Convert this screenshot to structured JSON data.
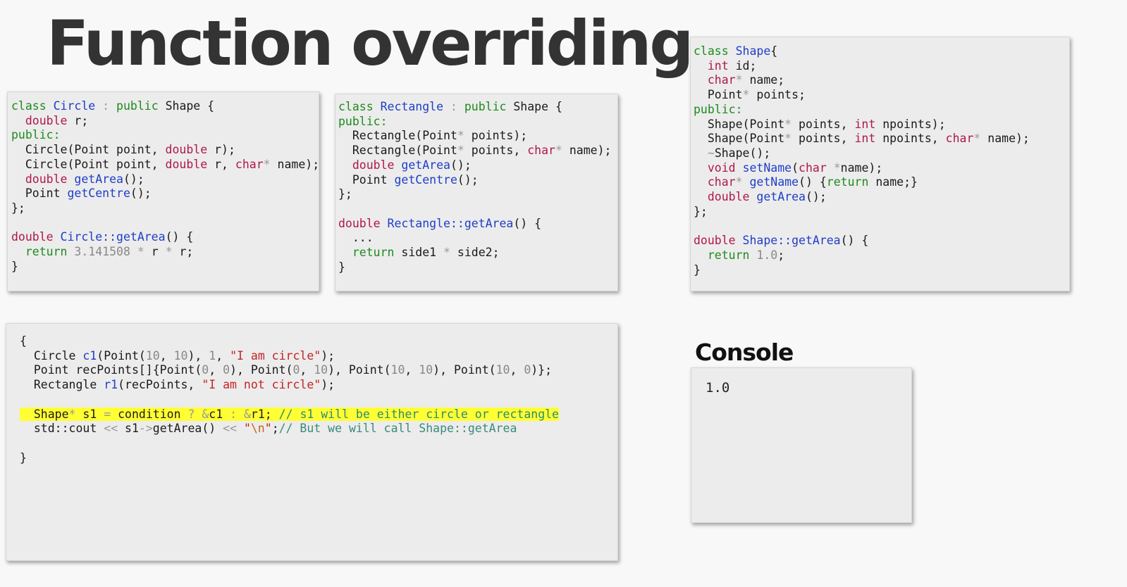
{
  "title": "Function overriding",
  "console": {
    "heading": "Console",
    "output": "1.0"
  },
  "code_panels": {
    "circle": [
      "class Circle : public Shape {",
      "  double r;",
      "public:",
      "  Circle(Point point, double r);",
      "  Circle(Point point, double r, char* name);",
      "  double getArea();",
      "  Point getCentre();",
      "};",
      "",
      "double Circle::getArea() {",
      "  return 3.141508 * r * r;",
      "}"
    ],
    "rectangle": [
      "class Rectangle : public Shape {",
      "public:",
      "  Rectangle(Point* points);",
      "  Rectangle(Point* points, char* name);",
      "  double getArea();",
      "  Point getCentre();",
      "};",
      "",
      "double Rectangle::getArea() {",
      "  ...",
      "  return side1 * side2;",
      "}"
    ],
    "shape": [
      "class Shape{",
      "  int id;",
      "  char* name;",
      "  Point* points;",
      "public:",
      "  Shape(Point* points, int npoints);",
      "  Shape(Point* points, int npoints, char* name);",
      "  ~Shape();",
      "  void setName(char *name);",
      "  char* getName() {return name;}",
      "  double getArea();",
      "};",
      "",
      "double Shape::getArea() {",
      "  return 1.0;",
      "}"
    ],
    "main": [
      "{",
      "  Circle c1(Point(10, 10), 1, \"I am circle\");",
      "  Point recPoints[]{Point(0, 0), Point(0, 10), Point(10, 10), Point(10, 0)};",
      "  Rectangle r1(recPoints, \"I am not circle\");",
      "",
      "  Shape* s1 = condition ? &c1 : &r1; // s1 will be either circle or rectangle",
      "  std::cout << s1->getArea() << \"\\n\";// But we will call Shape::getArea",
      "",
      "}"
    ]
  },
  "colors": {
    "keyword": "#1e8a1e",
    "type": "#b0174a",
    "function": "#1f3ec7",
    "number": "#888888",
    "string": "#c42424",
    "comment": "#3a8a7a",
    "highlight": "#ffff33"
  }
}
